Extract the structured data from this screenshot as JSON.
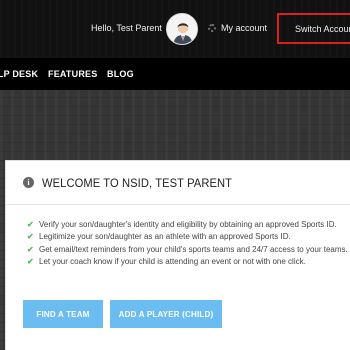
{
  "header": {
    "greeting": "Hello, Test Parent",
    "account_label": "My account",
    "switch_label": "Switch Account"
  },
  "nav": {
    "items": [
      "HELP DESK",
      "FEATURES",
      "BLOG"
    ]
  },
  "card": {
    "title": "WELCOME TO NSID, TEST PARENT",
    "bullets": [
      "Verify your son/daughter's identity and eligibility by obtaining an approved Sports ID.",
      "Legitimize your son/daughter as an athlete with an approved Sports ID.",
      "Get email/text reminders from your child's sports teams and 24/7 access to your teams.",
      "Let your coach know if your child is attending an event or not with one click."
    ],
    "buttons": {
      "find_team": "FIND A TEAM",
      "add_player": "ADD A PLAYER (CHILD)"
    }
  },
  "colors": {
    "highlight_border": "#d9221b",
    "button": "#6bbcf0",
    "check": "#5cb85c"
  },
  "icons": {
    "avatar": "user-avatar",
    "account": "gear-icon",
    "switch": "people-icon",
    "card": "info-icon",
    "bullet": "check-icon"
  }
}
